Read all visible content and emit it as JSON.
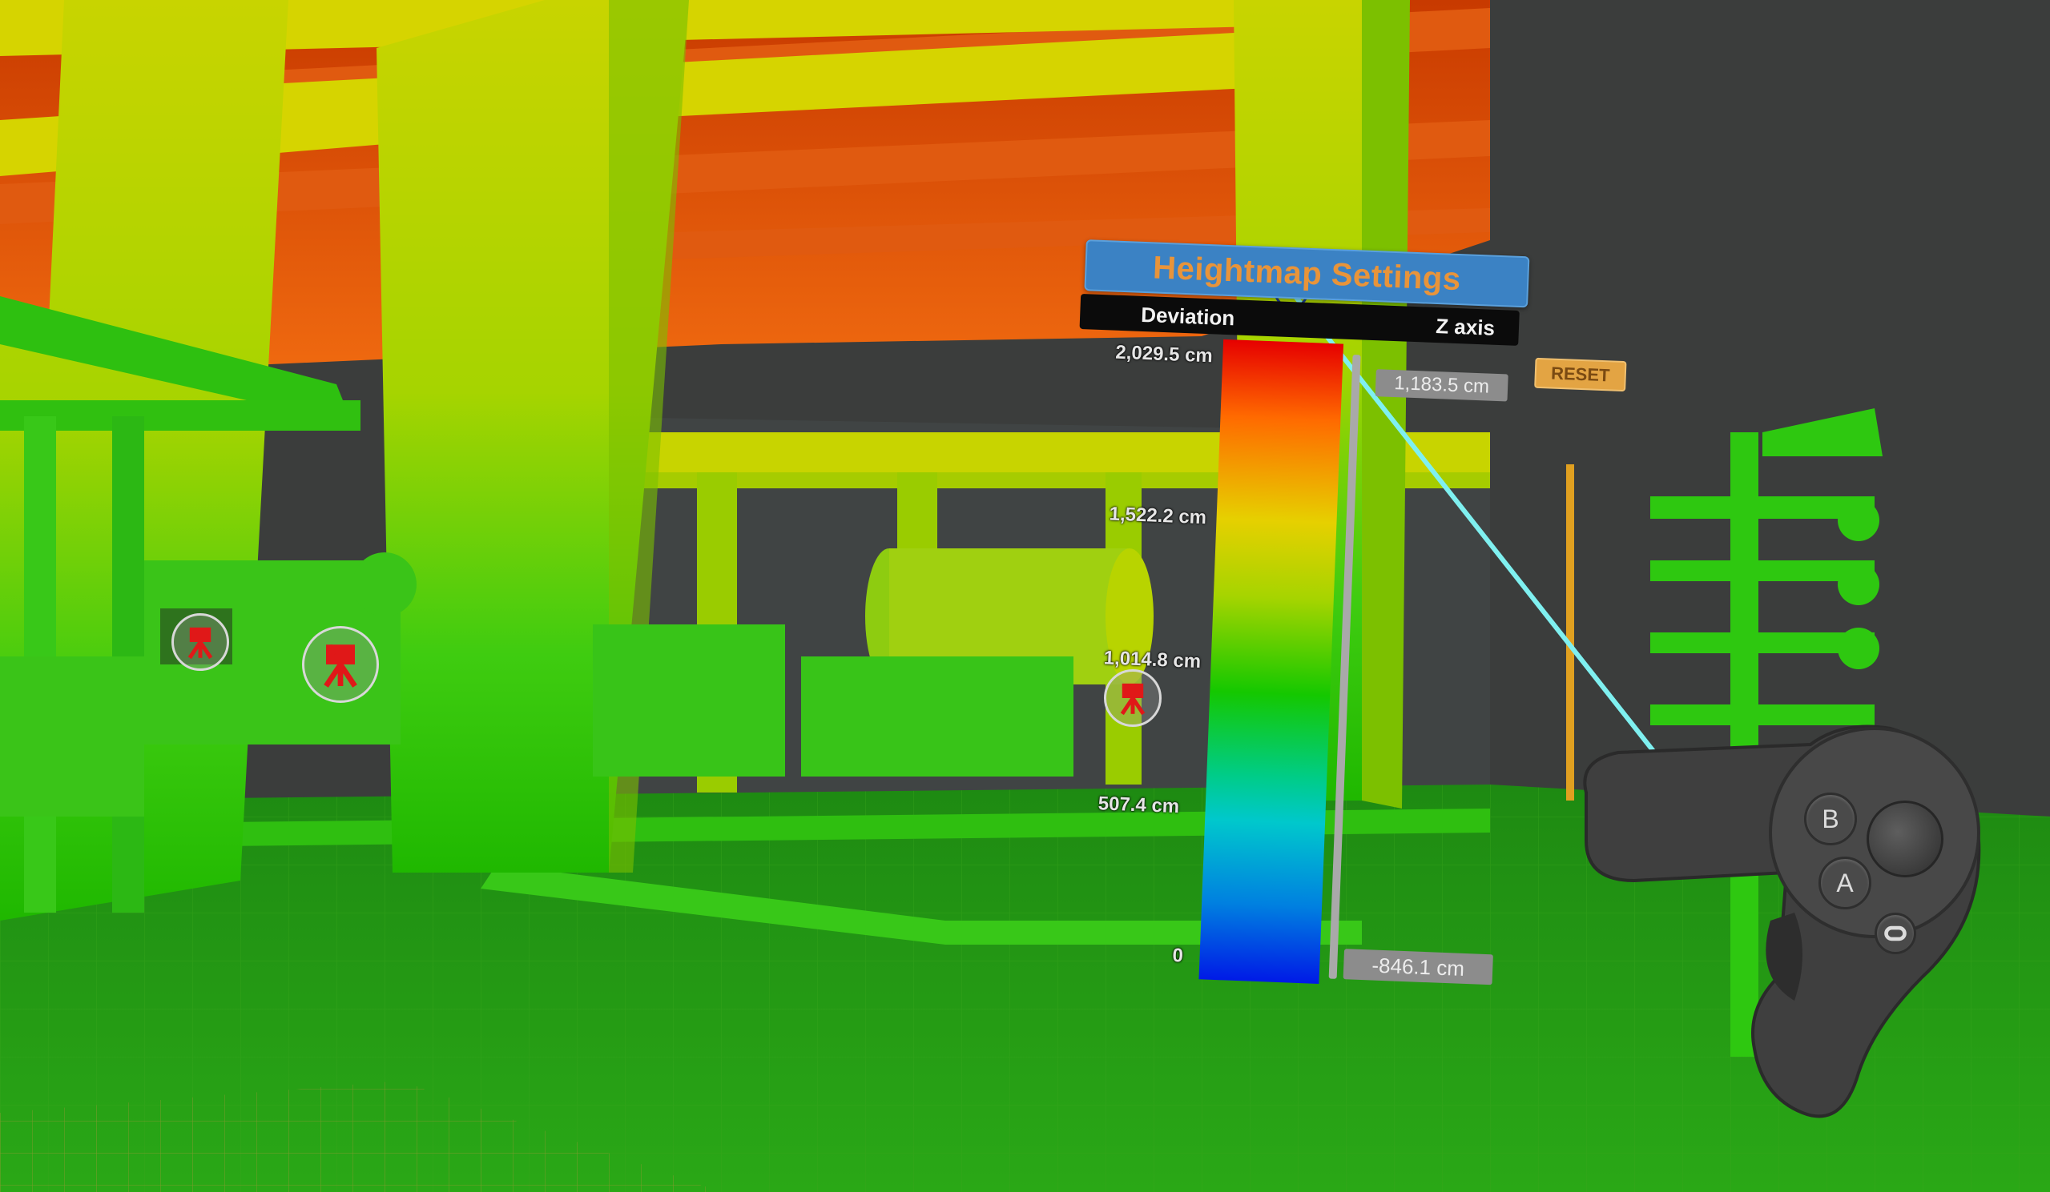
{
  "panel": {
    "title": "Heightmap Settings",
    "mode_left": "Deviation",
    "mode_right": "Z axis",
    "reset_label": "RESET",
    "scale_ticks": [
      "2,029.5 cm",
      "1,522.2 cm",
      "1,014.8 cm",
      "507.4 cm",
      "0"
    ],
    "max_value": "1,183.5 cm",
    "min_value": "-846.1 cm",
    "gradient_colors": [
      "#e60000",
      "#ff6a00",
      "#e6d000",
      "#14c800",
      "#00c8cc",
      "#001ae6"
    ]
  },
  "controller": {
    "button_b": "B",
    "button_a": "A",
    "menu_icon": "oculus-menu-icon"
  },
  "colors": {
    "pointer_ray": "#7ff0f0",
    "station_marker": "#e01818",
    "accent_title": "#3b82c4",
    "reset_button": "#e3a443"
  }
}
